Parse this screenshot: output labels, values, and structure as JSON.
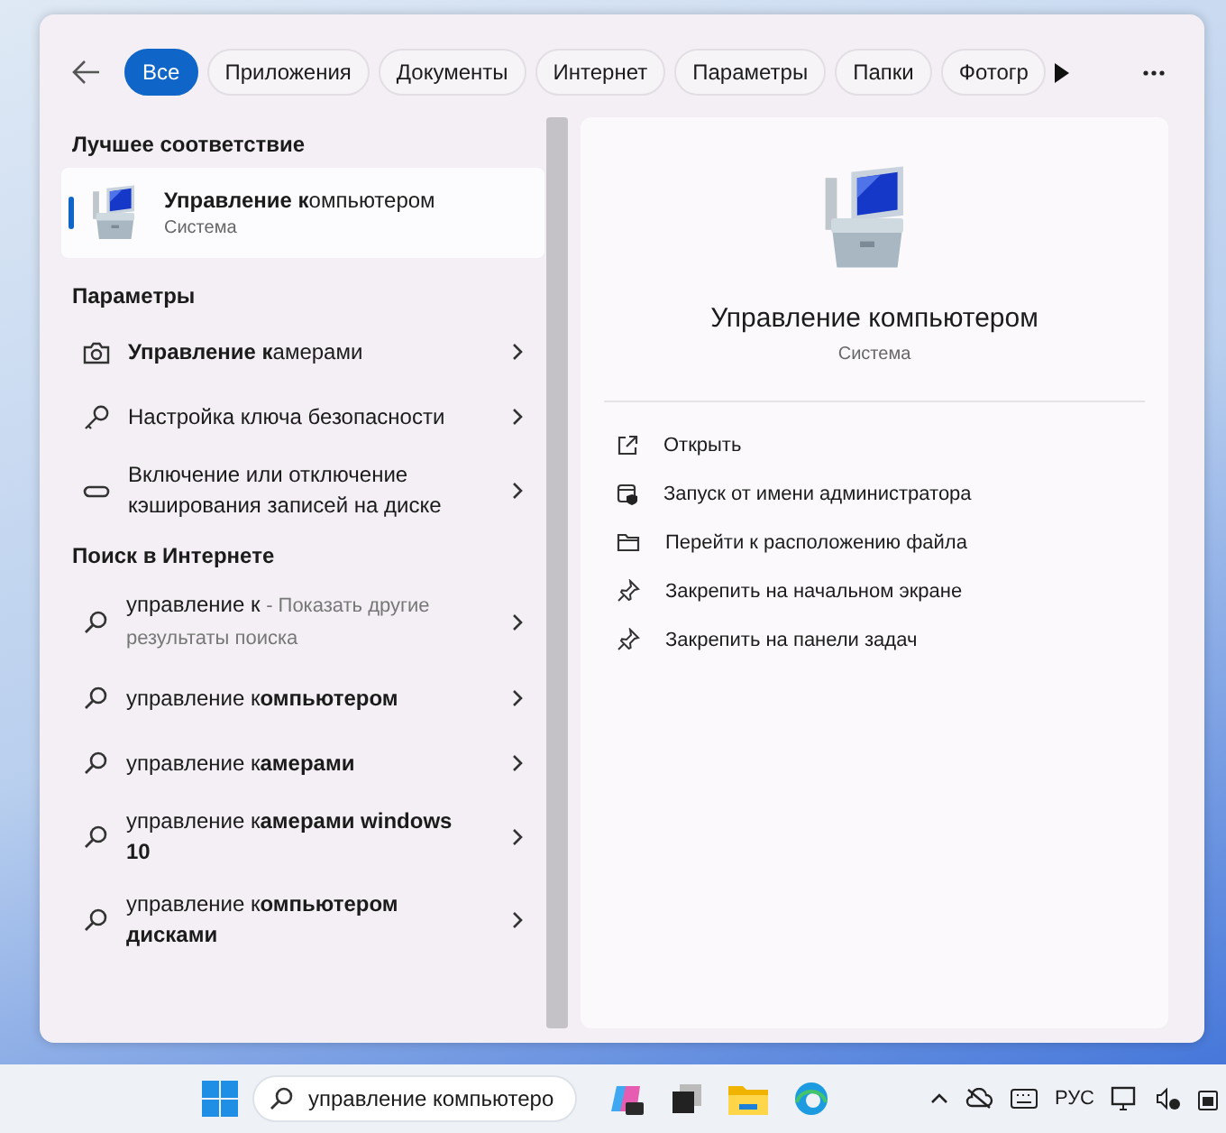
{
  "tabs": [
    {
      "label": "Все",
      "selected": true
    },
    {
      "label": "Приложения",
      "selected": false
    },
    {
      "label": "Документы",
      "selected": false
    },
    {
      "label": "Интернет",
      "selected": false
    },
    {
      "label": "Параметры",
      "selected": false
    },
    {
      "label": "Папки",
      "selected": false
    },
    {
      "label": "Фотогр",
      "selected": false
    }
  ],
  "best_match": {
    "heading": "Лучшее соответствие",
    "item": {
      "title": "**Управление к**омпьютером",
      "subtitle": "Система",
      "selected": true
    }
  },
  "settings": {
    "heading": "Параметры",
    "items": [
      {
        "kind": "camera",
        "label": "**Управление к**амерами"
      },
      {
        "kind": "key",
        "label": "Настройка ключа безопасности"
      },
      {
        "kind": "drive",
        "label": "Включение или отключение кэширования записей на диске"
      }
    ]
  },
  "web": {
    "heading": "Поиск в Интернете",
    "items": [
      {
        "query": "управление к",
        "hint": "- Показать другие результаты поиска"
      },
      {
        "query": "управление к**омпьютером**"
      },
      {
        "query": "управление к**амерами**"
      },
      {
        "query": "управление к**амерами windows 10**"
      },
      {
        "query": "управление к**омпьютером дисками**"
      }
    ]
  },
  "details": {
    "title": "Управление компьютером",
    "subtitle": "Система",
    "actions": [
      {
        "kind": "open",
        "label": "Открыть"
      },
      {
        "kind": "admin",
        "label": "Запуск от имени администратора"
      },
      {
        "kind": "folder",
        "label": "Перейти к расположению файла"
      },
      {
        "kind": "pin",
        "label": "Закрепить на начальном экране"
      },
      {
        "kind": "pin",
        "label": "Закрепить на панели задач"
      }
    ]
  },
  "taskbar": {
    "search": {
      "value": "управление компьютеро"
    },
    "language": "РУС"
  }
}
